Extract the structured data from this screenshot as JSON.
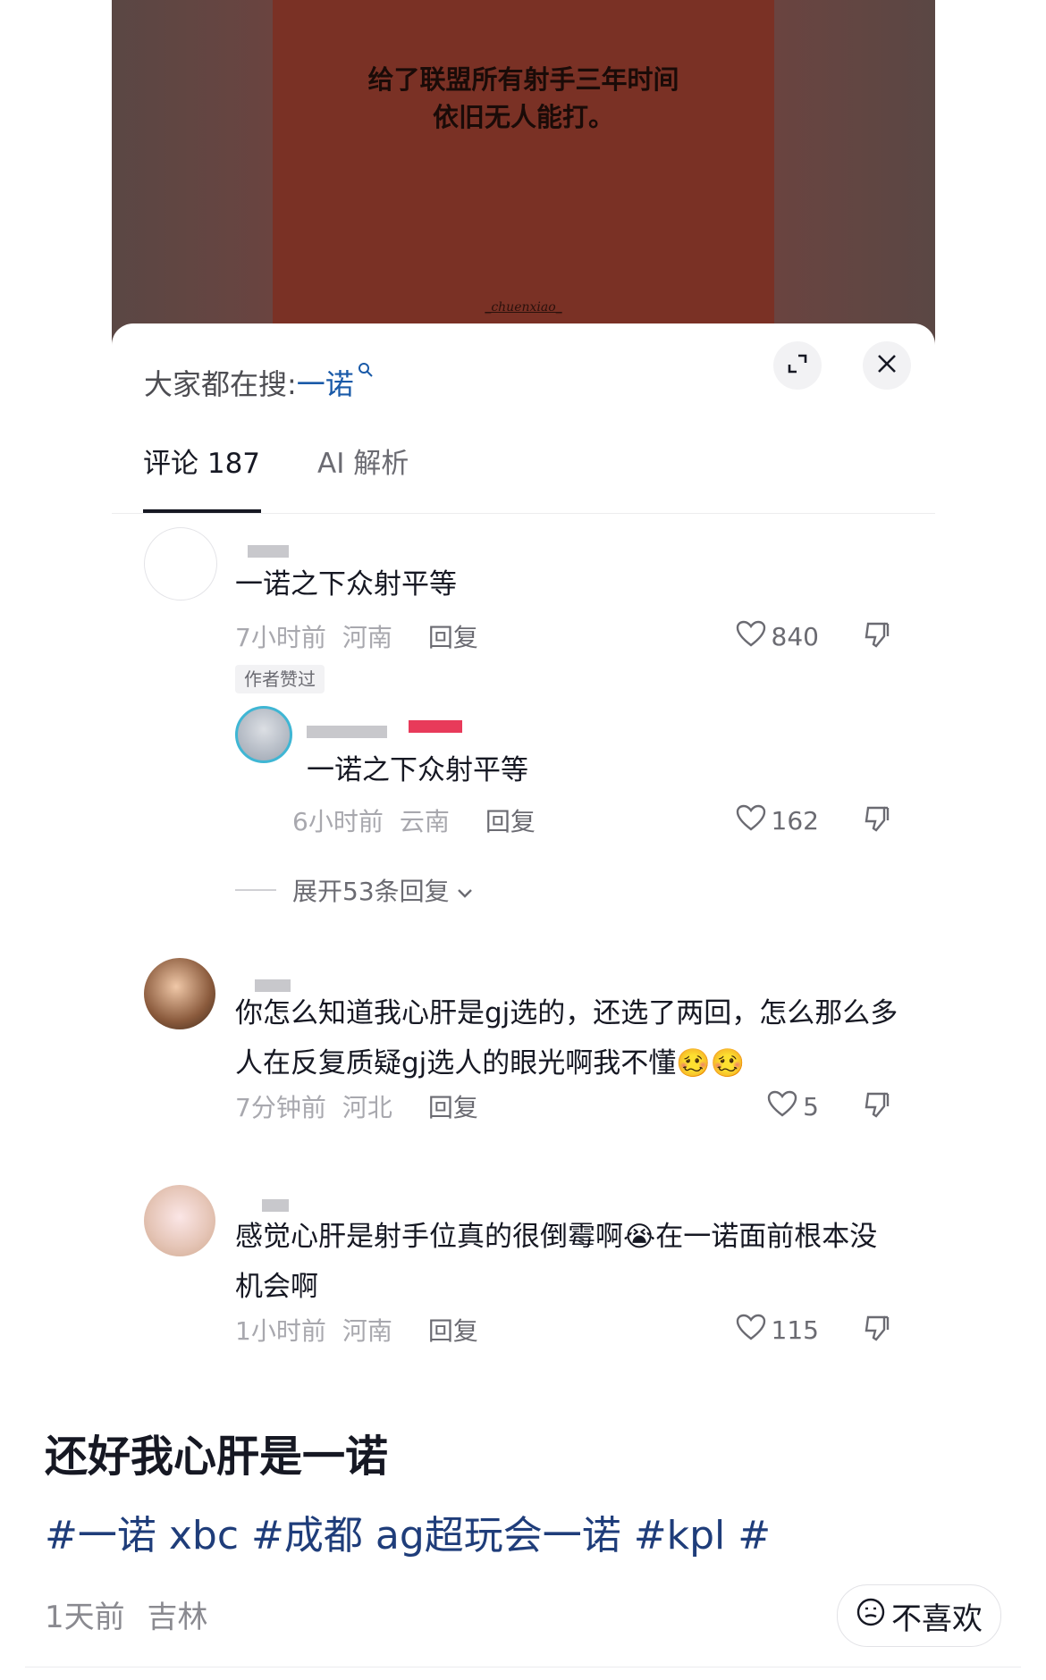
{
  "video": {
    "caption_line1": "给了联盟所有射手三年时间",
    "caption_line2": "依旧无人能打。",
    "watermark": "_chuenxiao_"
  },
  "search": {
    "prefix": "大家都在搜:",
    "term": "一诺"
  },
  "tabs": {
    "comments": "评论 187",
    "ai": "AI 解析"
  },
  "comments": [
    {
      "text": "一诺之下众射平等",
      "time": "7小时前",
      "location": "河南",
      "reply_label": "回复",
      "likes": "840",
      "badge": "作者赞过",
      "avatar_icon": "avatar-blank"
    },
    {
      "text": "一诺之下众射平等",
      "time": "6小时前",
      "location": "云南",
      "reply_label": "回复",
      "likes": "162",
      "avatar_icon": "avatar-user"
    },
    {
      "text": "你怎么知道我心肝是gj选的，还选了两回，怎么那么多人在反复质疑gj选人的眼光啊我不懂🥴🥴",
      "time": "7分钟前",
      "location": "河北",
      "reply_label": "回复",
      "likes": "5",
      "avatar_icon": "avatar-user"
    },
    {
      "text": "感觉心肝是射手位真的很倒霉啊😭在一诺面前根本没机会啊",
      "time": "1小时前",
      "location": "河南",
      "reply_label": "回复",
      "likes": "115",
      "avatar_icon": "avatar-user"
    }
  ],
  "expand_replies": "展开53条回复",
  "post": {
    "title": "还好我心肝是一诺",
    "hashtags": "#一诺 xbc #成都 ag超玩会一诺 #kpl #",
    "time": "1天前",
    "location": "吉林",
    "dislike_label": "不喜欢"
  },
  "colors": {
    "link": "#1a5aa8",
    "hashtag": "#1f3d7a",
    "video_bg": "#7a3125"
  }
}
